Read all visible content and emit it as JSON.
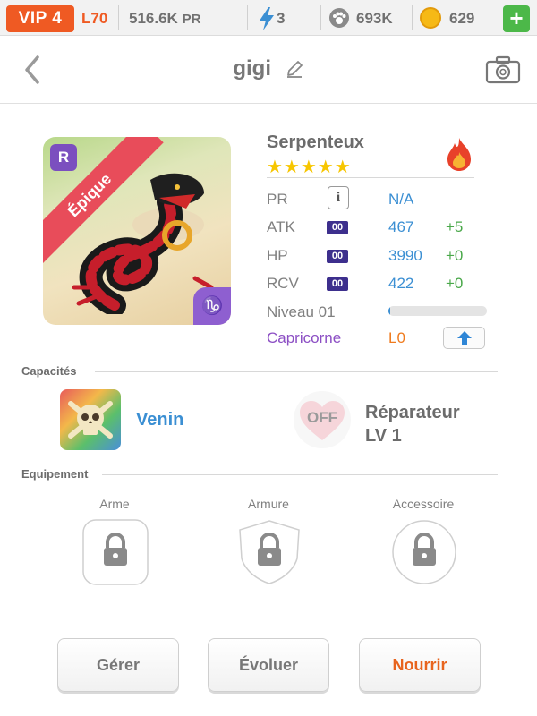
{
  "topbar": {
    "vip": "VIP 4",
    "level": "L70",
    "power": "516.6K",
    "power_unit": "PR",
    "energy": "3",
    "paws": "693K",
    "coins": "629",
    "add_label": "+"
  },
  "header": {
    "pet_name": "gigi"
  },
  "pet": {
    "rarity": "Épique",
    "rank_badge": "R",
    "species": "Serpenteux",
    "stars": "★★★★★",
    "star_count": 5,
    "element": "fire-icon",
    "stats": {
      "pr_label": "PR",
      "pr_value": "N/A",
      "info_label": "i",
      "atk_label": "ATK",
      "atk_tag": "00",
      "atk_value": "467",
      "atk_bonus": "+5",
      "hp_label": "HP",
      "hp_tag": "00",
      "hp_value": "3990",
      "hp_bonus": "+0",
      "rcv_label": "RCV",
      "rcv_tag": "00",
      "rcv_value": "422",
      "rcv_bonus": "+0"
    },
    "level_label": "Niveau 01",
    "level_progress": 0.02,
    "zodiac_sign": "Capricorne",
    "zodiac_level": "L0"
  },
  "abilities": {
    "title": "Capacités",
    "skill_name": "Venin",
    "talent_status": "OFF",
    "talent_name": "Réparateur",
    "talent_level": "LV 1"
  },
  "equipment": {
    "title": "Equipement",
    "slots": [
      "Arme",
      "Armure",
      "Accessoire"
    ]
  },
  "actions": {
    "manage": "Gérer",
    "evolve": "Évoluer",
    "feed": "Nourrir"
  },
  "colors": {
    "accent_orange": "#ef5a23",
    "link_blue": "#3b8fd3",
    "bonus_green": "#4aa84a",
    "zodiac_purple": "#8c4fc4",
    "rarity_red": "#e84c5a"
  }
}
